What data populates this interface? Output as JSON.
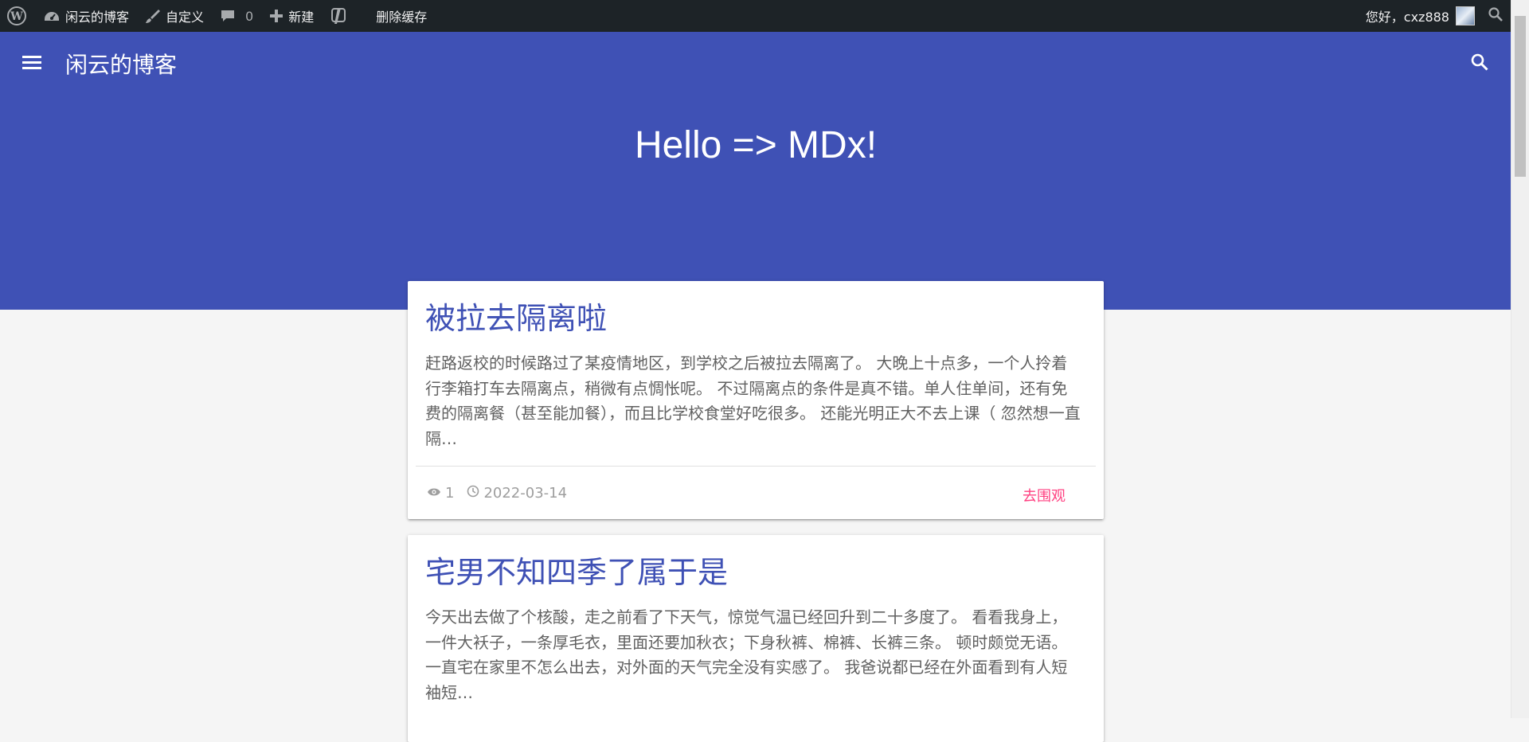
{
  "adminbar": {
    "site_name": "闲云的博客",
    "customize": "自定义",
    "comments_count": "0",
    "new_label": "新建",
    "clear_cache": "删除缓存",
    "greeting": "您好，cxz888"
  },
  "header": {
    "site_title": "闲云的博客",
    "hero_text": "Hello => MDx!"
  },
  "posts": [
    {
      "title": "被拉去隔离啦",
      "excerpt": "赶路返校的时候路过了某疫情地区，到学校之后被拉去隔离了。 大晚上十点多，一个人拎着行李箱打车去隔离点，稍微有点惆怅呢。 不过隔离点的条件是真不错。单人住单间，还有免费的隔离餐（甚至能加餐），而且比学校食堂好吃很多。 还能光明正大不去上课（ 忽然想一直隔…",
      "views": "1",
      "date": "2022-03-14",
      "action": "去围观"
    },
    {
      "title": "宅男不知四季了属于是",
      "excerpt": "今天出去做了个核酸，走之前看了下天气，惊觉气温已经回升到二十多度了。 看看我身上，一件大袄子，一条厚毛衣，里面还要加秋衣；下身秋裤、棉裤、长裤三条。 顿时颇觉无语。 一直宅在家里不怎么出去，对外面的天气完全没有实感了。 我爸说都已经在外面看到有人短袖短…"
    }
  ],
  "colors": {
    "primary": "#3f51b5",
    "accent": "#ff4081",
    "adminbar": "#1d2327"
  }
}
